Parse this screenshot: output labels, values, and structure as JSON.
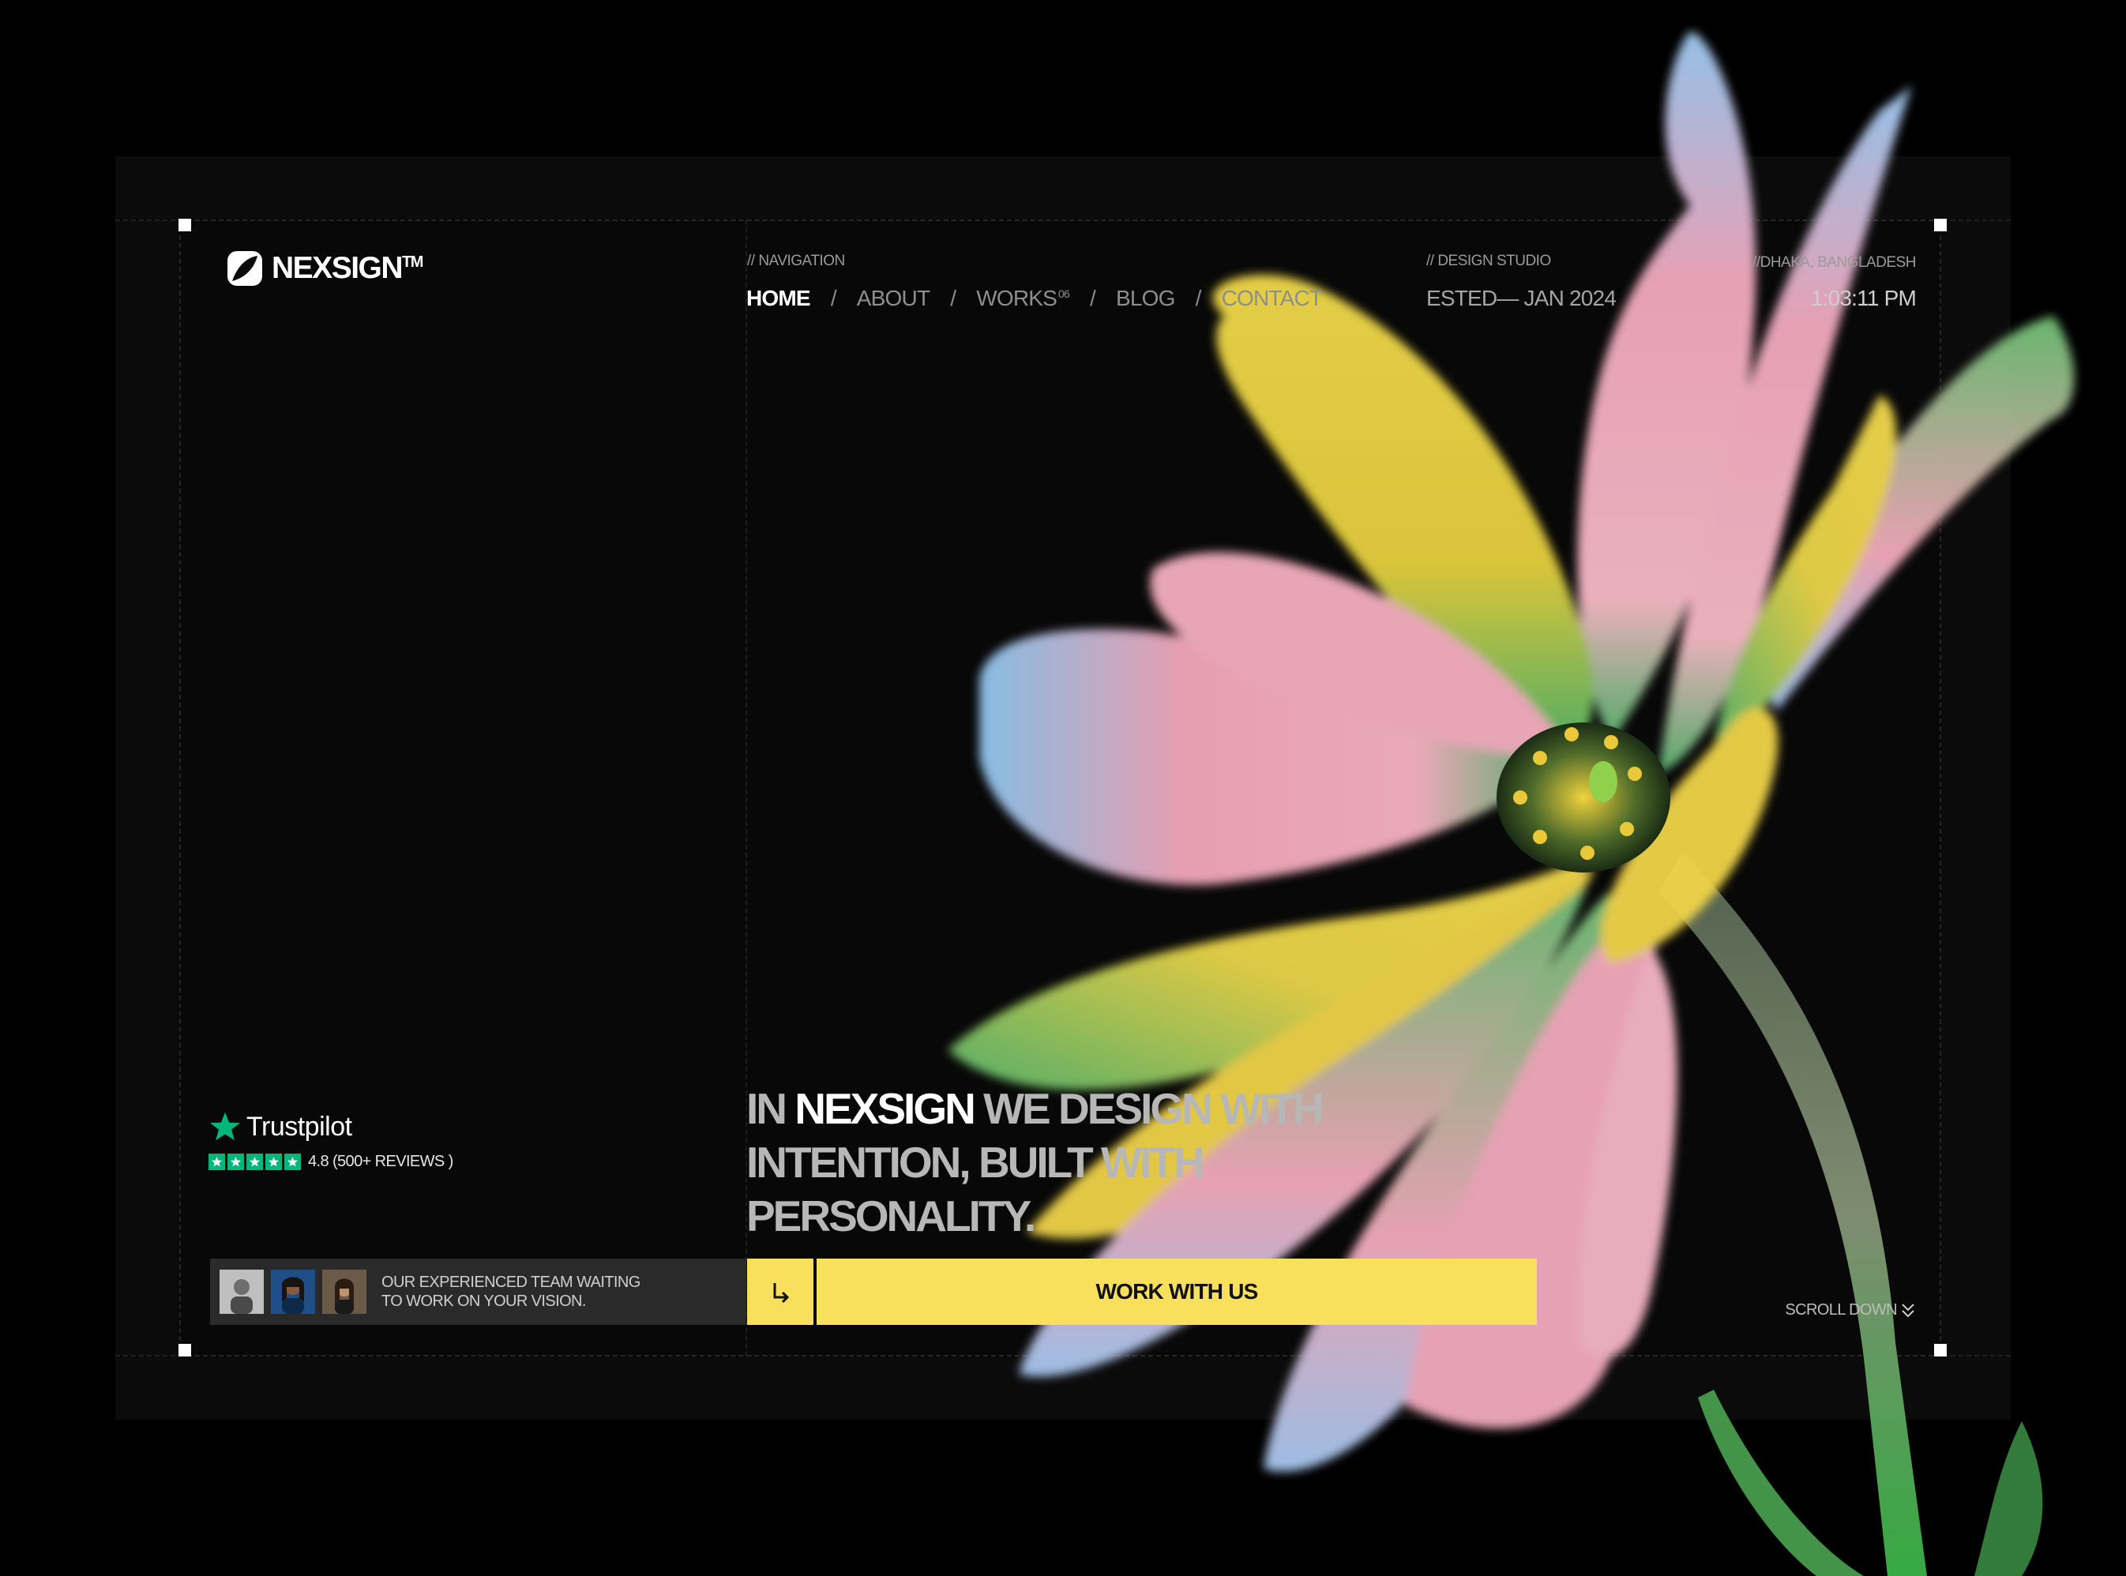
{
  "brand": {
    "name": "NEXSIGN",
    "tm": "TM"
  },
  "navigation": {
    "label": "// NAVIGATION",
    "items": [
      {
        "label": "HOME",
        "active": true
      },
      {
        "label": "ABOUT"
      },
      {
        "label": "WORKS",
        "sup": "06"
      },
      {
        "label": "BLOG"
      },
      {
        "label": "CONTACT"
      }
    ],
    "separator": "/"
  },
  "studio": {
    "label": "// DESIGN STUDIO",
    "value": "ESTED— JAN 2024"
  },
  "location": {
    "label": "//DHAKA, BANGLADESH",
    "time": "1:03:11 PM"
  },
  "hero": {
    "line_prefix": "IN ",
    "highlight": "NEXSIGN",
    "line_rest": " WE DESIGN WITH INTENTION, BUILT WITH PERSONALITY."
  },
  "trustpilot": {
    "name": "Trustpilot",
    "rating": "4.8 (500+ REVIEWS )",
    "stars": 5,
    "color": "#00b67a"
  },
  "team": {
    "text": "OUR EXPERIENCED TEAM WAITING\nTO WORK ON YOUR VISION."
  },
  "cta": {
    "label": "WORK WITH US",
    "color": "#f9e05c",
    "arrow_icon": "arrow-down-right-icon"
  },
  "scroll": {
    "label": "SCROLL DOWN",
    "icon": "double-chevron-down-icon"
  }
}
